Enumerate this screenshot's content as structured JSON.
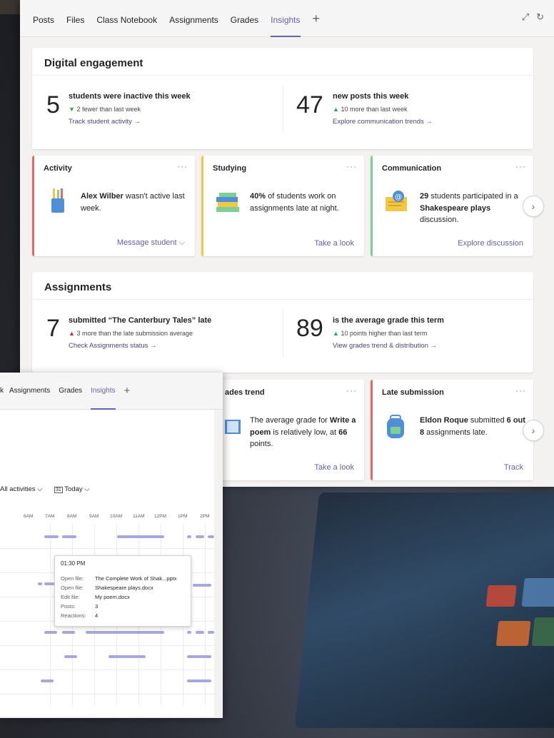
{
  "main": {
    "tabs": [
      "Posts",
      "Files",
      "Class Notebook",
      "Assignments",
      "Grades",
      "Insights"
    ],
    "active_tab": "Insights",
    "add_tab": "+",
    "expand_icon": "⤢",
    "refresh_icon": "↻"
  },
  "digital": {
    "title": "Digital engagement",
    "left": {
      "number": "5",
      "headline": "students were inactive this week",
      "delta": "2 fewer than last week",
      "delta_dir": "down",
      "link": "Track student activity →"
    },
    "right": {
      "number": "47",
      "headline": "new posts this week",
      "delta": "10 more than last week",
      "delta_dir": "up",
      "link": "Explore communication trends →"
    }
  },
  "cards_row1": [
    {
      "title": "Activity",
      "color": "#e3676c",
      "name_bold": "Alex Wilber",
      "text": " wasn't active last week.",
      "action": "Message student ⌵"
    },
    {
      "title": "Studying",
      "color": "#f2c744",
      "bold": "40%",
      "text": " of students work on assignments late at night.",
      "action": "Take a look"
    },
    {
      "title": "Communication",
      "color": "#7fcf94",
      "bold": "29",
      "text": " students participated in a ",
      "bold2": "Shakespeare plays",
      "text2": " discussion.",
      "action": "Explore discussion"
    }
  ],
  "assignments": {
    "title": "Assignments",
    "left": {
      "number": "7",
      "headline": "submitted “The Canterbury Tales” late",
      "delta": "3 more than the late submission average",
      "link": "Check Assignments status →"
    },
    "right": {
      "number": "89",
      "headline": "is the average grade this term",
      "delta": "10 points higher than last term",
      "link": "View grades trend & distribution →"
    }
  },
  "cards_row2": [
    {
      "title": "ades trend",
      "text_a": "The average grade for ",
      "bold": "Write a poem",
      "text_b": " is relatively low, at ",
      "bold2": "66",
      "text_c": " points.",
      "action": "Take a look"
    },
    {
      "title": "Late submission",
      "color": "#e3676c",
      "bold": "Eldon Roque",
      "text": " submitted ",
      "bold2": "6 out 8",
      "text2": " assignments late.",
      "action": "Track"
    }
  ],
  "second": {
    "tabs": [
      "k",
      "Assignments",
      "Grades",
      "Insights"
    ],
    "active_tab": "Insights",
    "add_tab": "+",
    "filter_activities": "All activities ⌵",
    "filter_date": "Today ⌵",
    "date_icon": "31",
    "hours": [
      "6AM",
      "7AM",
      "8AM",
      "9AM",
      "10AM",
      "11AM",
      "12PM",
      "1PM",
      "2PM"
    ]
  },
  "tooltip": {
    "time": "01:30 PM",
    "rows": [
      {
        "label": "Open file:",
        "value": "The Complete Work of Shak...pptx"
      },
      {
        "label": "Open file:",
        "value": "Shakespeare plays.docx"
      },
      {
        "label": "Edit file:",
        "value": "My poem.docx"
      },
      {
        "label": "Posts:",
        "value": "3"
      },
      {
        "label": "Reactions:",
        "value": "4"
      }
    ]
  },
  "colors": {
    "accent": "#6264a7",
    "activity": "#e3676c",
    "studying": "#f2c744",
    "communication": "#7fcf94"
  }
}
